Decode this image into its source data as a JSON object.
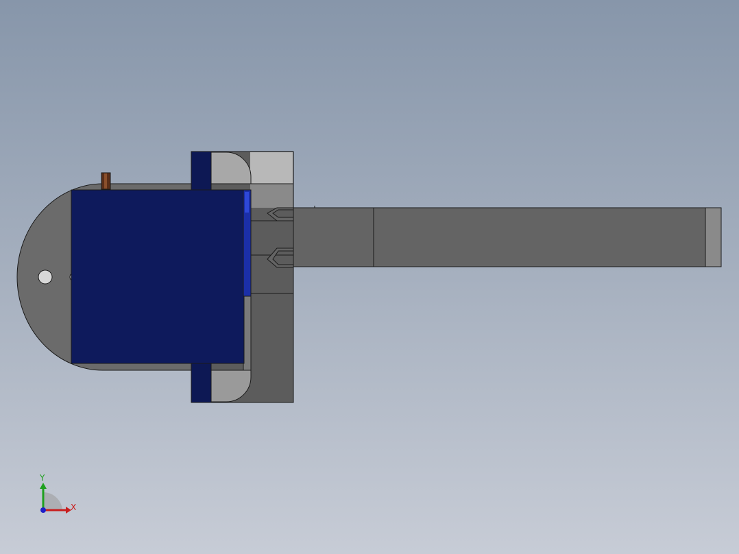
{
  "viewport": {
    "background_top": "#8796aa",
    "background_bottom": "#c7ccd6"
  },
  "model": {
    "servo_body_color": "#0d1854",
    "housing_color": "#6a6a6a",
    "housing_light_color": "#b4b4b4",
    "arm_color": "#646464",
    "pin_color": "#5a2e18",
    "edge_color": "#1a1a1a"
  },
  "triad": {
    "x_label": "X",
    "y_label": "Y",
    "x_color": "#c81e1e",
    "y_color": "#1ea01e",
    "z_color": "#1e1ec8"
  }
}
